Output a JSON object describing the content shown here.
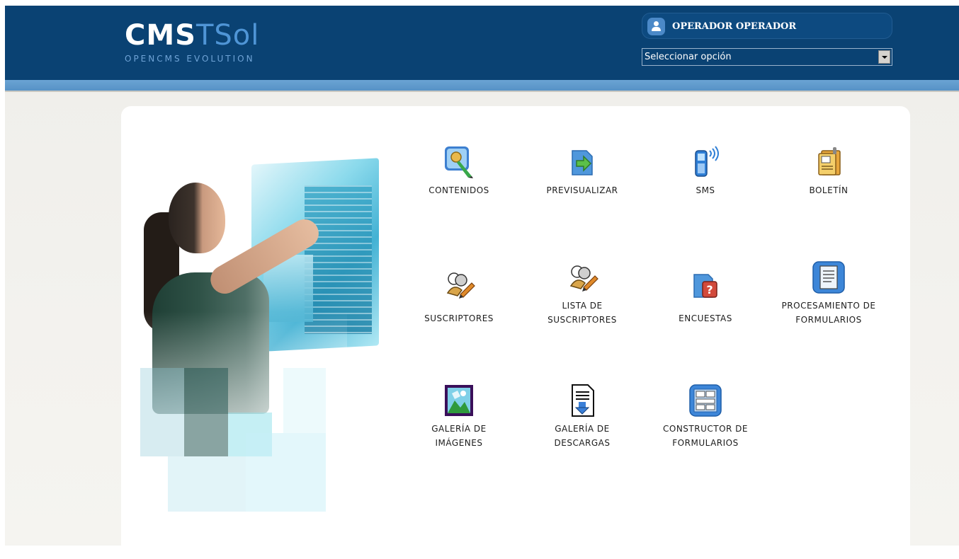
{
  "header": {
    "logo_main_bold": "CMS",
    "logo_main_light": "TSol",
    "logo_tagline": "OPENCMS EVOLUTION",
    "user_name": "OPERADOR OPERADOR",
    "select_value": "Seleccionar opción",
    "colors": {
      "bar": "#0a4273",
      "stripe": "#5b96c9",
      "logo_accent": "#4f95d6"
    }
  },
  "modules": [
    {
      "id": "contenidos",
      "icon": "content-edit-icon",
      "label_lines": [
        "CONTENIDOS"
      ]
    },
    {
      "id": "previsualizar",
      "icon": "preview-arrow-icon",
      "label_lines": [
        "PREVISUALIZAR"
      ]
    },
    {
      "id": "sms",
      "icon": "mobile-phone-icon",
      "label_lines": [
        "SMS"
      ]
    },
    {
      "id": "boletin",
      "icon": "newsletter-icon",
      "label_lines": [
        "BOLETÍN"
      ]
    },
    {
      "id": "suscriptores",
      "icon": "subscribers-icon",
      "label_lines": [
        "SUSCRIPTORES"
      ]
    },
    {
      "id": "lista-suscriptores",
      "icon": "subscriber-list-icon",
      "label_lines": [
        "LISTA DE",
        "SUSCRIPTORES"
      ]
    },
    {
      "id": "encuestas",
      "icon": "survey-icon",
      "label_lines": [
        "ENCUESTAS"
      ]
    },
    {
      "id": "procesamiento",
      "icon": "form-processing-icon",
      "label_lines": [
        "PROCESAMIENTO DE",
        "FORMULARIOS"
      ]
    },
    {
      "id": "galeria-imagenes",
      "icon": "image-gallery-icon",
      "label_lines": [
        "GALERÍA DE",
        "IMÁGENES"
      ]
    },
    {
      "id": "galeria-descargas",
      "icon": "download-gallery-icon",
      "label_lines": [
        "GALERÍA DE",
        "DESCARGAS"
      ]
    },
    {
      "id": "constructor",
      "icon": "form-builder-icon",
      "label_lines": [
        "CONSTRUCTOR DE",
        "FORMULARIOS"
      ]
    }
  ]
}
